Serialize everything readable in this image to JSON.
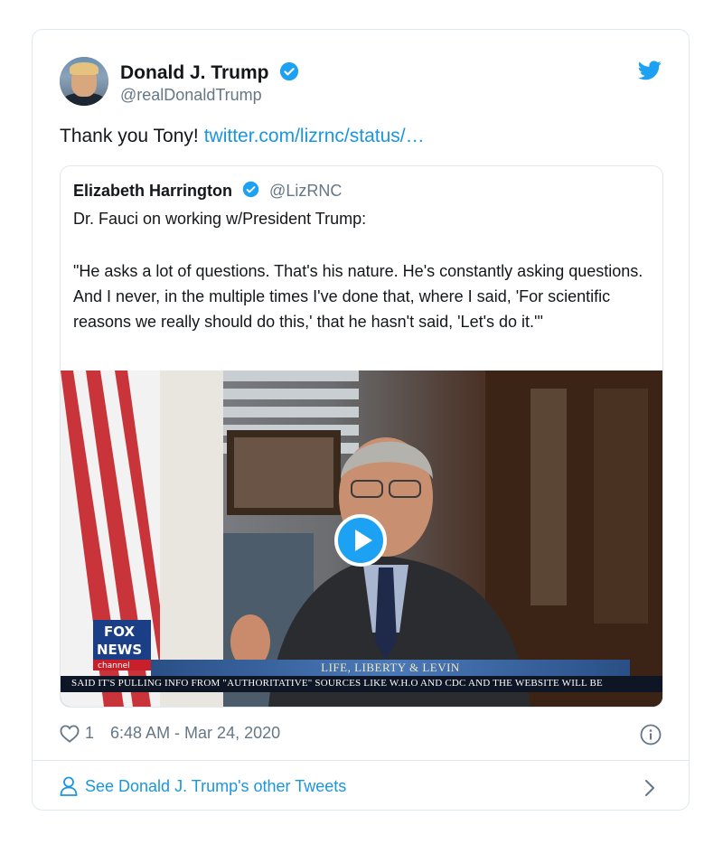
{
  "author": {
    "name": "Donald J. Trump",
    "handle": "@realDonaldTrump"
  },
  "tweet": {
    "text": "Thank you Tony!",
    "link": "twitter.com/lizrnc/status/…"
  },
  "quoted": {
    "name": "Elizabeth Harrington",
    "handle": "@LizRNC",
    "line1": "Dr. Fauci on working w/President Trump:",
    "body": "\"He asks a lot of questions. That's his nature. He's constantly asking questions. And I never, in the multiple times I've done that, where I said, 'For scientific reasons we really should do this,' that he hasn't said, 'Let's do it.'\""
  },
  "video": {
    "network_logo": "FOX NEWS channel",
    "banner": "LIFE, LIBERTY & LEVIN",
    "ticker": "SAID IT'S PULLING INFO FROM \"AUTHORITATIVE\" SOURCES LIKE W.H.O AND CDC AND THE WEBSITE WILL BE"
  },
  "meta": {
    "likes": "1",
    "timestamp": "6:48 AM - Mar 24, 2020"
  },
  "footer": {
    "see_more": "See Donald J. Trump's other Tweets"
  },
  "icons": [
    "verified-icon",
    "twitter-bird-icon",
    "play-icon",
    "heart-icon",
    "info-icon",
    "person-icon",
    "chevron-right-icon"
  ],
  "colors": {
    "accent": "#1b95e0",
    "verified": "#1da1f2",
    "muted": "#657786",
    "border": "#e1e8ed"
  }
}
